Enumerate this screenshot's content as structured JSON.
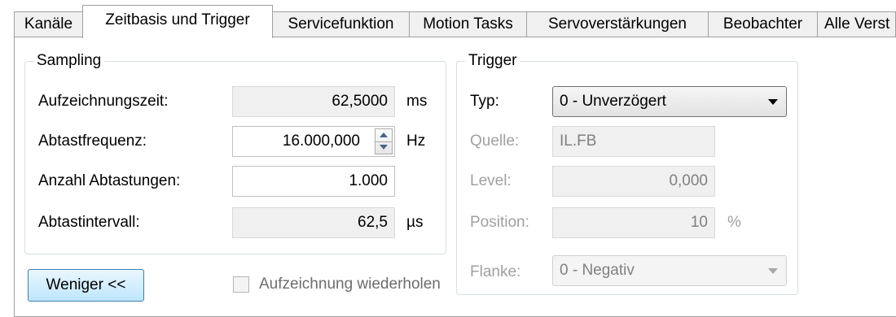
{
  "tabs": [
    {
      "label": "Kanäle"
    },
    {
      "label": "Zeitbasis und Trigger"
    },
    {
      "label": "Servicefunktion"
    },
    {
      "label": "Motion Tasks"
    },
    {
      "label": "Servoverstärkungen"
    },
    {
      "label": "Beobachter"
    },
    {
      "label": "Alle Verst"
    }
  ],
  "active_tab": "Zeitbasis und Trigger",
  "sampling": {
    "title": "Sampling",
    "aufzeichnungszeit": {
      "label": "Aufzeichnungszeit:",
      "value": "62,5000",
      "unit": "ms"
    },
    "abtastfrequenz": {
      "label": "Abtastfrequenz:",
      "value": "16.000,000",
      "unit": "Hz"
    },
    "anzahl": {
      "label": "Anzahl Abtastungen:",
      "value": "1.000"
    },
    "abtastintervall": {
      "label": "Abtastintervall:",
      "value": "62,5",
      "unit": "µs"
    }
  },
  "trigger": {
    "title": "Trigger",
    "typ": {
      "label": "Typ:",
      "value": "0 - Unverzögert"
    },
    "quelle": {
      "label": "Quelle:",
      "value": "IL.FB"
    },
    "level": {
      "label": "Level:",
      "value": "0,000"
    },
    "position": {
      "label": "Position:",
      "value": "10",
      "unit": "%"
    },
    "flanke": {
      "label": "Flanke:",
      "value": "0 - Negativ"
    }
  },
  "buttons": {
    "weniger": "Weniger <<"
  },
  "repeat": {
    "label": "Aufzeichnung wiederholen",
    "checked": false
  }
}
